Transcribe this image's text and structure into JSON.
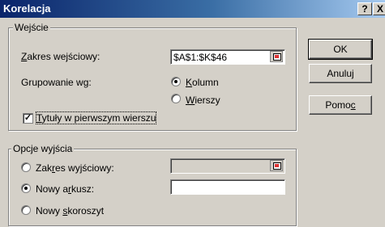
{
  "window": {
    "title": "Korelacja",
    "help_btn": "?",
    "close_btn": "X"
  },
  "input_group": {
    "legend": "Wejście",
    "range_label": "Zakres wejściowy:",
    "range_value": "$A$1:$K$46",
    "grouping_label": "Grupowanie wg:",
    "opt_columns": "Kolumn",
    "opt_rows": "Wierszy",
    "grouping_selected": "Kolumn",
    "labels_first_row": "Tytuły w pierwszym wierszu",
    "labels_checked": true
  },
  "output_group": {
    "legend": "Opcje wyjścia",
    "opt_output_range": "Zakres wyjściowy:",
    "opt_new_sheet": "Nowy arkusz:",
    "opt_new_workbook": "Nowy skoroszyt",
    "selected": "Nowy arkusz:",
    "output_range_value": "",
    "new_sheet_value": ""
  },
  "buttons": {
    "ok": "OK",
    "cancel": "Anuluj",
    "help": "Pomoc"
  }
}
